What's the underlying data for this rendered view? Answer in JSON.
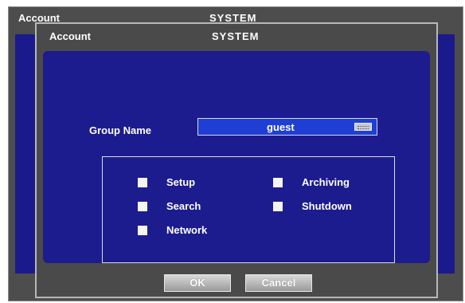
{
  "background_window": {
    "title": "Account",
    "system_label": "SYSTEM"
  },
  "dialog": {
    "title": "Account",
    "system_label": "SYSTEM",
    "group_name_label": "Group Name",
    "group_name_value": "guest",
    "permissions": [
      {
        "label": "Setup",
        "checked": false
      },
      {
        "label": "Archiving",
        "checked": false
      },
      {
        "label": "Search",
        "checked": false
      },
      {
        "label": "Shutdown",
        "checked": false
      },
      {
        "label": "Network",
        "checked": false
      }
    ],
    "buttons": {
      "ok": "OK",
      "cancel": "Cancel"
    }
  },
  "icons": {
    "keyboard": "keyboard-icon"
  },
  "colors": {
    "panel_blue": "#1c1c8e",
    "input_blue": "#1f3fd4",
    "frame_gray": "#4a4a4a"
  }
}
